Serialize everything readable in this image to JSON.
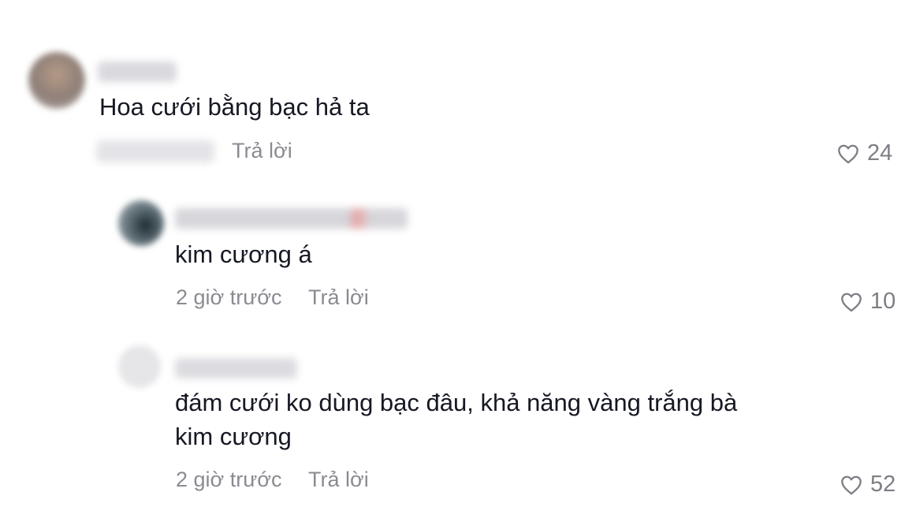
{
  "comments": [
    {
      "text": "Hoa cưới bằng bạc hả ta",
      "reply_label": "Trả lời",
      "likes": "24"
    },
    {
      "text": "kim cương á",
      "time": "2 giờ trước",
      "reply_label": "Trả lời",
      "likes": "10"
    },
    {
      "text_line1": "đám cưới ko dùng bạc đâu, khả năng vàng trắng bà",
      "text_line2": "kim cương",
      "time": "2 giờ trước",
      "reply_label": "Trả lời",
      "likes": "52"
    }
  ],
  "icons": {
    "like": "heart-outline-icon"
  },
  "colors": {
    "text": "#161823",
    "meta": "#8a8b91",
    "background": "#ffffff"
  }
}
